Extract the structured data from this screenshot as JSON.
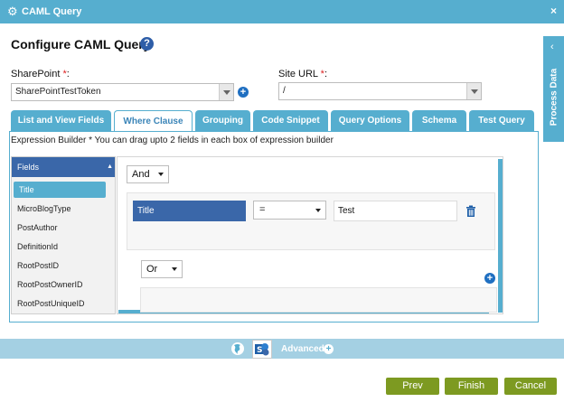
{
  "window": {
    "title": "CAML Query",
    "close_glyph": "×"
  },
  "page": {
    "heading": "Configure CAML Query",
    "help_glyph": "?"
  },
  "sharepoint": {
    "label": "SharePoint ",
    "required": "*",
    "colon": ":",
    "value": "SharePointTestToken"
  },
  "site_url": {
    "label": "Site URL ",
    "required": "*",
    "colon": ":",
    "value": "/"
  },
  "side_panel": {
    "label": "Process Data",
    "chevron": "‹"
  },
  "tabs": [
    {
      "label": "List and View Fields"
    },
    {
      "label": "Where Clause"
    },
    {
      "label": "Grouping"
    },
    {
      "label": "Code Snippet"
    },
    {
      "label": "Query Options"
    },
    {
      "label": "Schema"
    },
    {
      "label": "Test Query"
    }
  ],
  "active_tab": "Where Clause",
  "expression_builder": {
    "note": "Expression Builder * You can drag upto 2 fields in each box of expression builder",
    "fields_header": "Fields",
    "fields": [
      "Title",
      "MicroBlogType",
      "PostAuthor",
      "DefinitionId",
      "RootPostID",
      "RootPostOwnerID",
      "RootPostUniqueID"
    ],
    "selected_field": "Title",
    "logic_top": "And",
    "condition": {
      "field": "Title",
      "operator": "=",
      "value": "Test"
    },
    "logic_nested": "Or"
  },
  "footer": {
    "advanced_label": "Advanced"
  },
  "buttons": {
    "prev": "Prev",
    "finish": "Finish",
    "cancel": "Cancel"
  },
  "colors": {
    "accent": "#56aecf",
    "field_blue": "#3a67a9",
    "button_green": "#7d9a21"
  }
}
